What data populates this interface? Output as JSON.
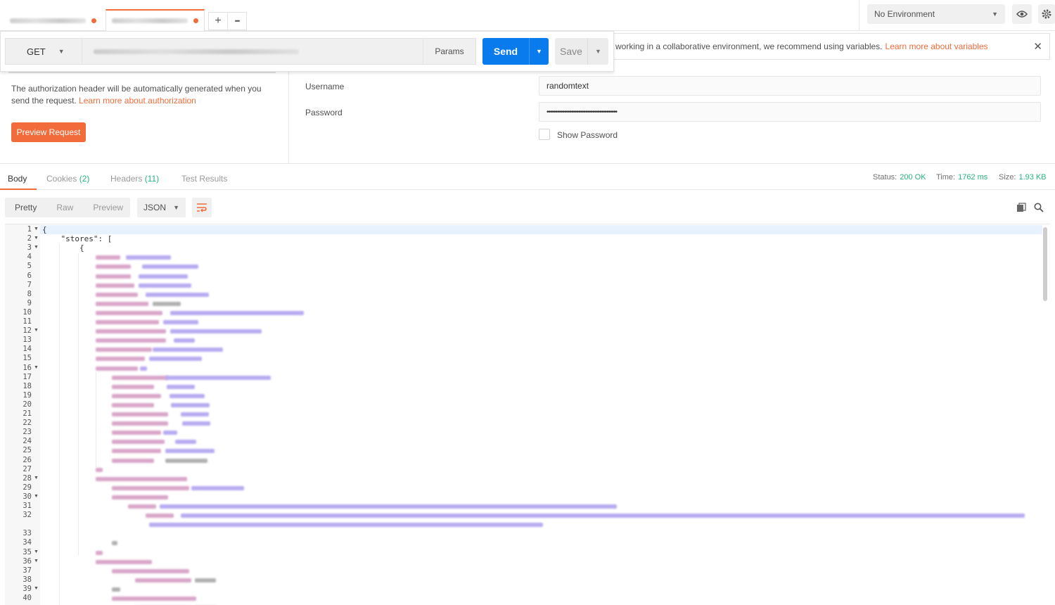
{
  "tabs": {
    "add_label": "+",
    "more_label": "•••"
  },
  "environment": {
    "selected": "No Environment"
  },
  "request": {
    "method": "GET",
    "params_label": "Params",
    "send_label": "Send",
    "save_label": "Save"
  },
  "banner": {
    "text": "working in a collaborative environment, we recommend using variables.",
    "link": "Learn more about variables",
    "close": "✕"
  },
  "auth": {
    "hint": "The authorization header will be automatically generated when you send the request.",
    "hint_link": "Learn more about authorization",
    "preview_button": "Preview Request",
    "username_label": "Username",
    "username_value": "randomtext",
    "password_label": "Password",
    "password_value": "••••••••••••••••••••••••••••••••••••••••",
    "show_password_label": "Show Password"
  },
  "response": {
    "tabs": [
      {
        "label": "Body",
        "count": ""
      },
      {
        "label": "Cookies",
        "count": "(2)"
      },
      {
        "label": "Headers",
        "count": "(11)"
      },
      {
        "label": "Test Results",
        "count": ""
      }
    ],
    "status_label": "Status:",
    "status_value": "200 OK",
    "time_label": "Time:",
    "time_value": "1762 ms",
    "size_label": "Size:",
    "size_value": "1.93 KB",
    "format_modes": [
      "Pretty",
      "Raw",
      "Preview"
    ],
    "format_type": "JSON",
    "code_line1": "{",
    "code_line2": "    \"stores\": [",
    "code_line3": "        {",
    "line_numbers": [
      "1",
      "2",
      "3",
      "4",
      "5",
      "6",
      "7",
      "8",
      "9",
      "10",
      "11",
      "12",
      "13",
      "14",
      "15",
      "16",
      "17",
      "18",
      "19",
      "20",
      "21",
      "22",
      "23",
      "24",
      "25",
      "26",
      "27",
      "28",
      "29",
      "30",
      "31",
      "32",
      "33",
      "34",
      "35",
      "36",
      "37",
      "38",
      "39",
      "40"
    ]
  },
  "colors": {
    "accent": "#f26b3a",
    "send": "#097bed",
    "status_ok": "#26b47f"
  }
}
